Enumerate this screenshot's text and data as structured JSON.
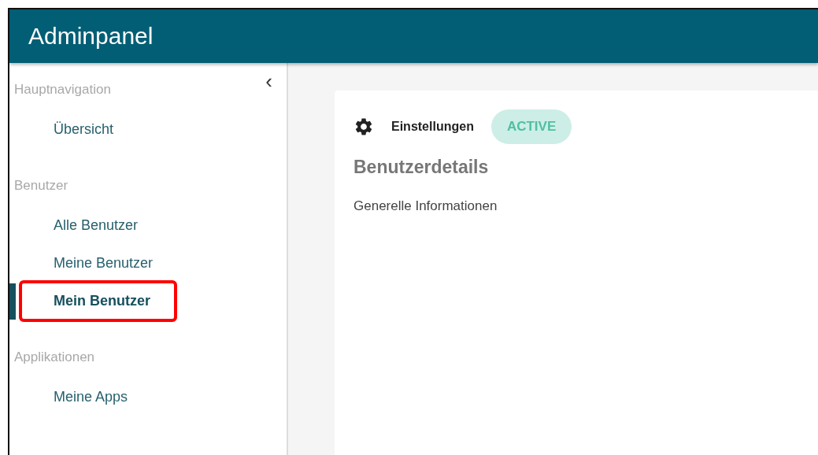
{
  "header": {
    "title": "Adminpanel"
  },
  "sidebar": {
    "collapse_icon": "‹",
    "sections": [
      {
        "label": "Hauptnavigation",
        "items": [
          {
            "label": "Übersicht",
            "selected": false,
            "highlighted": false
          }
        ]
      },
      {
        "label": "Benutzer",
        "items": [
          {
            "label": "Alle Benutzer",
            "selected": false,
            "highlighted": false
          },
          {
            "label": "Meine Benutzer",
            "selected": false,
            "highlighted": false
          },
          {
            "label": "Mein Benutzer",
            "selected": true,
            "highlighted": true
          }
        ]
      },
      {
        "label": "Applikationen",
        "items": [
          {
            "label": "Meine Apps",
            "selected": false,
            "highlighted": false
          }
        ]
      }
    ]
  },
  "card": {
    "tab": "Einstellungen",
    "status": "ACTIVE",
    "heading": "Benutzerdetails",
    "subheading": "Generelle Informationen"
  }
}
